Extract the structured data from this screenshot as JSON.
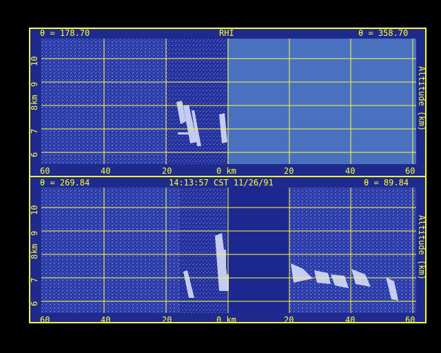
{
  "top_panel": {
    "left_angle": "θ = 178.70",
    "title": "RHI",
    "right_angle": "θ = 358.70",
    "x_ticks": [
      "60",
      "40",
      "20",
      "0 km",
      "20",
      "40",
      "60"
    ],
    "y_ticks": [
      "6",
      "7",
      "8",
      "9",
      "10"
    ],
    "y_label_left": "km",
    "y_label_right": "Altitude (km)"
  },
  "bottom_panel": {
    "left_angle": "θ = 269.84",
    "title": "14:13:57 CST 11/26/91",
    "right_angle": "θ = 89.84",
    "x_ticks": [
      "60",
      "40",
      "20",
      "0 km",
      "20",
      "40",
      "60"
    ],
    "y_ticks": [
      "6",
      "7",
      "8",
      "9",
      "10"
    ],
    "y_label_left": "km",
    "y_label_right": "Altitude (km)"
  },
  "colors": {
    "frame": "#ffff33",
    "background": "#1c2890",
    "no_data": "#4a70c0",
    "echo": "#e6ecff"
  }
}
